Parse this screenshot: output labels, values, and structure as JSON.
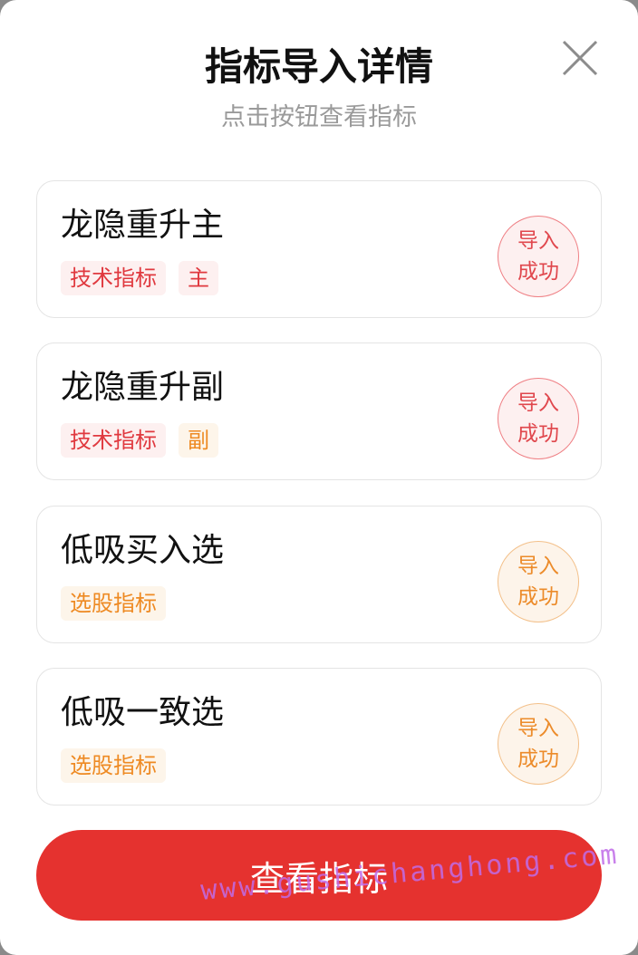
{
  "header": {
    "title": "指标导入详情",
    "subtitle": "点击按钮查看指标"
  },
  "items": [
    {
      "name": "龙隐重升主",
      "tags": [
        "技术指标",
        "主"
      ],
      "status_line1": "导入",
      "status_line2": "成功",
      "theme": "red"
    },
    {
      "name": "龙隐重升副",
      "tags": [
        "技术指标",
        "副"
      ],
      "status_line1": "导入",
      "status_line2": "成功",
      "theme": "red"
    },
    {
      "name": "低吸买入选",
      "tags": [
        "选股指标"
      ],
      "status_line1": "导入",
      "status_line2": "成功",
      "theme": "orange"
    },
    {
      "name": "低吸一致选",
      "tags": [
        "选股指标"
      ],
      "status_line1": "导入",
      "status_line2": "成功",
      "theme": "orange"
    }
  ],
  "button": {
    "label": "查看指标"
  },
  "watermark": "www.gushichanghong.com",
  "colors": {
    "primary": "#e5322f",
    "tag_red": "#e0393f",
    "tag_orange": "#ee8a23"
  }
}
